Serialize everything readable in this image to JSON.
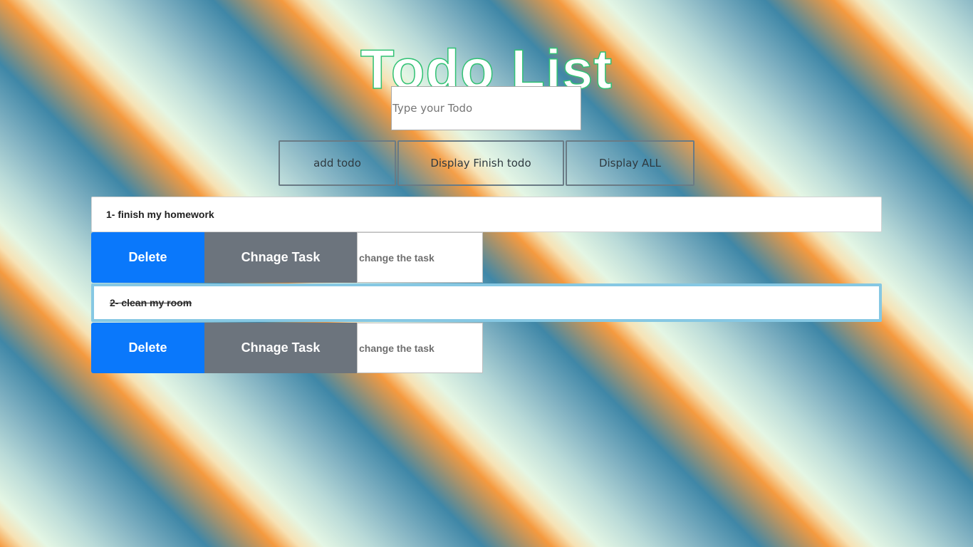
{
  "app": {
    "title": "Todo List"
  },
  "input": {
    "placeholder": "Type your Todo",
    "value": ""
  },
  "controls": {
    "add_label": "add todo",
    "display_finish_label": "Display Finish todo",
    "display_all_label": "Display ALL"
  },
  "todos": [
    {
      "text": "1- finish my homework",
      "done": false,
      "delete_label": "Delete",
      "change_label": "Chnage Task",
      "change_placeholder": "change the task"
    },
    {
      "text": "2- clean my room",
      "done": true,
      "delete_label": "Delete",
      "change_label": "Chnage Task",
      "change_placeholder": "change the task"
    }
  ],
  "colors": {
    "title_stroke": "#33c275",
    "delete_button": "#0a78fb",
    "change_button": "#6c747d",
    "active_item_border": "#86c8e3",
    "background_stripes": [
      "#f59a3f",
      "#e4f6e4",
      "#3f87a7"
    ]
  }
}
